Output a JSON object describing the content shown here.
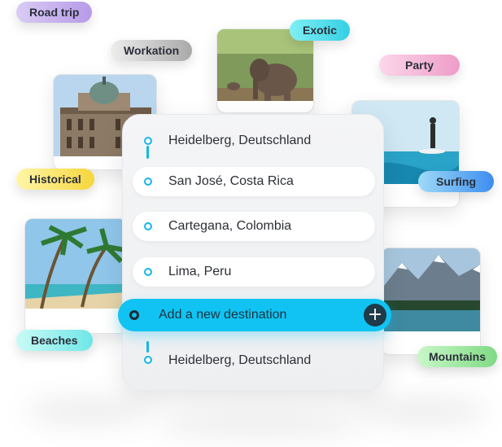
{
  "tags": {
    "road_trip": "Road trip",
    "workation": "Workation",
    "exotic": "Exotic",
    "party": "Party",
    "historical": "Historical",
    "surfing": "Surfing",
    "beaches": "Beaches",
    "mountains": "Mountains"
  },
  "route": {
    "start": "Heidelberg, Deutschland",
    "stops": [
      "San José, Costa Rica",
      "Cartegana, Colombia",
      "Lima, Peru"
    ],
    "add_placeholder": "Add a new destination",
    "add_icon": "+",
    "end": "Heidelberg, Deutschland"
  },
  "colors": {
    "accent": "#10c3f2",
    "stem": "#12b8e6"
  }
}
